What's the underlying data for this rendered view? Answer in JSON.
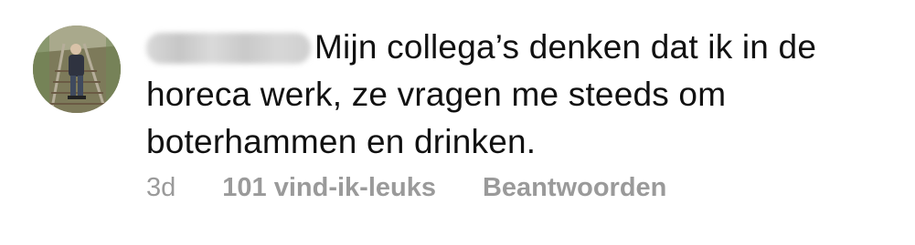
{
  "comment": {
    "username_blurred": true,
    "text": "Mijn collega’s denken dat ik in de horeca werk, ze vragen me steeds om boterhammen en drinken.",
    "time": "3d",
    "likes": "101 vind-ik-leuks",
    "reply_label": "Beantwoorden"
  },
  "colors": {
    "text": "#111111",
    "meta": "#9a9a9a",
    "background": "#ffffff"
  }
}
